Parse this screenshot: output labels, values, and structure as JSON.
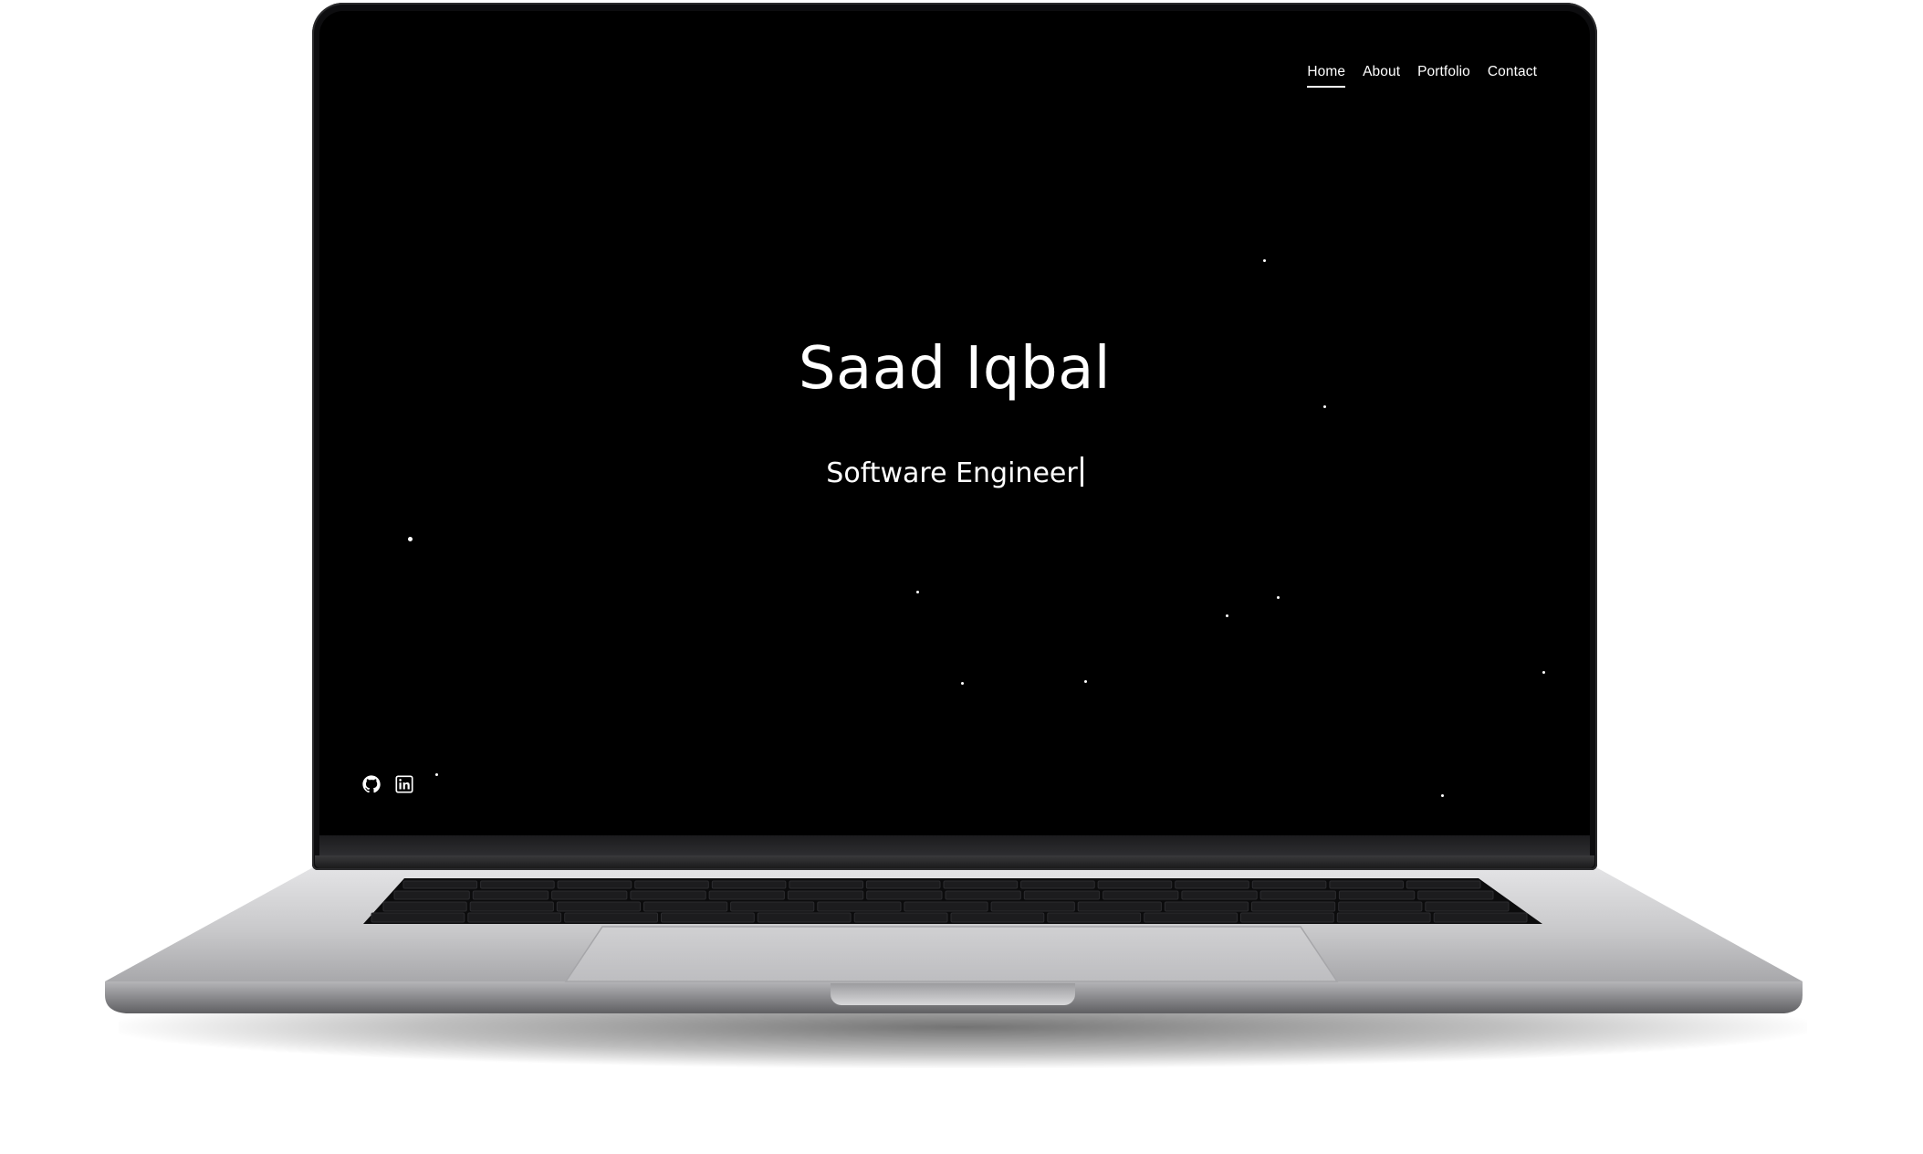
{
  "nav": {
    "items": [
      {
        "label": "Home",
        "active": true
      },
      {
        "label": "About",
        "active": false
      },
      {
        "label": "Portfolio",
        "active": false
      },
      {
        "label": "Contact",
        "active": false
      }
    ]
  },
  "hero": {
    "name": "Saad Iqbal",
    "role": "Software Engineer"
  },
  "social": {
    "icons": [
      "github-icon",
      "linkedin-icon"
    ]
  },
  "colors": {
    "screen_background": "#000000",
    "text": "#ffffff",
    "laptop_body": "#c8c8ca"
  }
}
